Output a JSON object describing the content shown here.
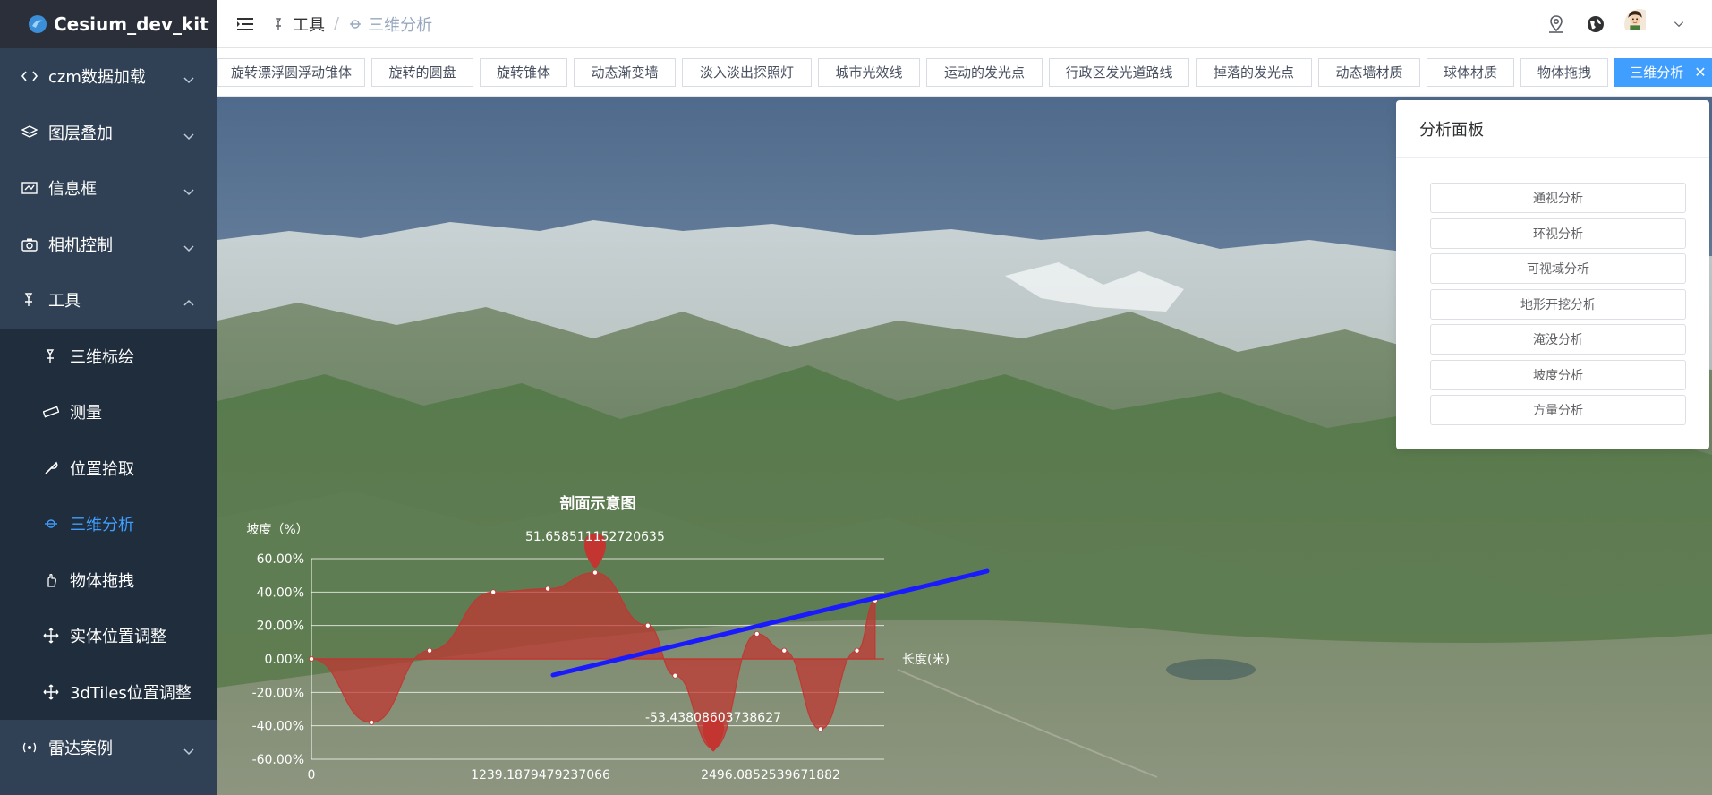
{
  "app": {
    "title": "Cesium_dev_kit"
  },
  "sidebar": {
    "items": [
      {
        "label": "czm数据加载",
        "icon": "code-icon",
        "expanded": false
      },
      {
        "label": "图层叠加",
        "icon": "layers-icon",
        "expanded": false
      },
      {
        "label": "信息框",
        "icon": "info-box-icon",
        "expanded": false
      },
      {
        "label": "相机控制",
        "icon": "camera-icon",
        "expanded": false
      },
      {
        "label": "工具",
        "icon": "tool-icon",
        "expanded": true
      },
      {
        "label": "雷达案例",
        "icon": "radar-icon",
        "expanded": false
      }
    ],
    "tools_children": [
      {
        "label": "三维标绘",
        "icon": "draw-icon"
      },
      {
        "label": "测量",
        "icon": "ruler-icon"
      },
      {
        "label": "位置拾取",
        "icon": "pick-icon"
      },
      {
        "label": "三维分析",
        "icon": "analysis-icon",
        "active": true
      },
      {
        "label": "物体拖拽",
        "icon": "drag-icon"
      },
      {
        "label": "实体位置调整",
        "icon": "move-icon"
      },
      {
        "label": "3dTiles位置调整",
        "icon": "move-icon"
      }
    ]
  },
  "breadcrumb": {
    "first": "工具",
    "separator": "/",
    "current": "三维分析"
  },
  "tags": [
    {
      "label": "旋转漂浮圆浮动锥体",
      "w": 165
    },
    {
      "label": "旋转的圆盘",
      "w": 114
    },
    {
      "label": "旋转锥体",
      "w": 98
    },
    {
      "label": "动态渐变墙",
      "w": 114
    },
    {
      "label": "淡入淡出探照灯",
      "w": 145
    },
    {
      "label": "城市光效线",
      "w": 114
    },
    {
      "label": "运动的发光点",
      "w": 130
    },
    {
      "label": "行政区发光道路线",
      "w": 157
    },
    {
      "label": "掉落的发光点",
      "w": 130
    },
    {
      "label": "动态墙材质",
      "w": 114
    },
    {
      "label": "球体材质",
      "w": 98
    },
    {
      "label": "物体拖拽",
      "w": 98
    },
    {
      "label": "三维分析",
      "w": 120,
      "active": true,
      "close": "✕"
    }
  ],
  "panel": {
    "title": "分析面板",
    "buttons": [
      "通视分析",
      "环视分析",
      "可视域分析",
      "地形开挖分析",
      "淹没分析",
      "坡度分析",
      "方量分析"
    ]
  },
  "colors": {
    "sidebar": "#304156",
    "accent": "#409eff",
    "series": "#c23531",
    "line": "#1a1aff"
  },
  "chart_data": {
    "type": "area",
    "title": "剖面示意图",
    "ylabel": "坡度（%）",
    "xlabel": "长度(米)",
    "ylim": [
      -60,
      60
    ],
    "yticks": [
      "60.00%",
      "40.00%",
      "20.00%",
      "0.00%",
      "-20.00%",
      "-40.00%",
      "-60.00%"
    ],
    "xtick_labels": [
      "0",
      "1239.1879479237066",
      "2496.0852539671882"
    ],
    "max_label": "51.658511152720635",
    "min_label": "-53.43808603738627",
    "series": [
      {
        "values": [
          [
            0,
            0
          ],
          [
            330,
            -38
          ],
          [
            650,
            5
          ],
          [
            1000,
            40
          ],
          [
            1300,
            42
          ],
          [
            1560,
            51.66
          ],
          [
            1850,
            20
          ],
          [
            2000,
            -10
          ],
          [
            2210,
            -53.44
          ],
          [
            2450,
            15
          ],
          [
            2600,
            5
          ],
          [
            2800,
            -42
          ],
          [
            3000,
            5
          ],
          [
            3100,
            35
          ]
        ]
      }
    ],
    "xmax": 3150
  }
}
